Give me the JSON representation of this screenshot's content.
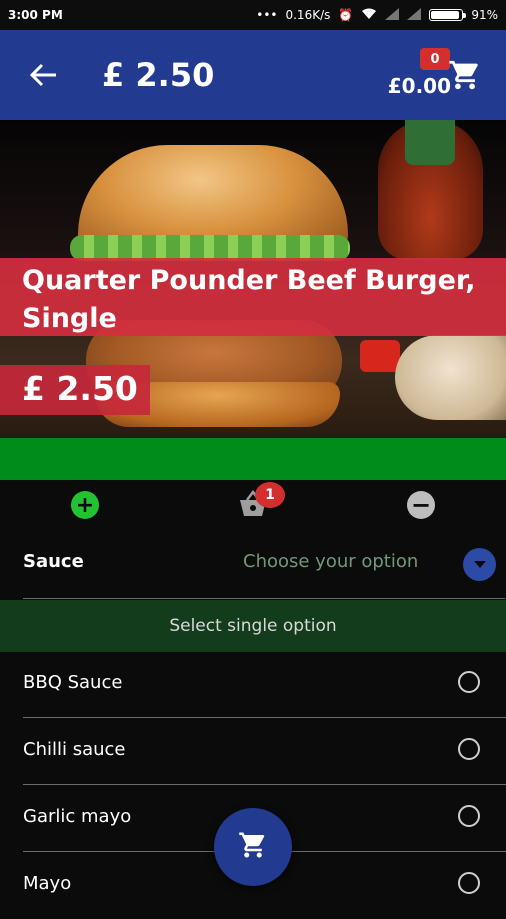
{
  "status_bar": {
    "time": "3:00 PM",
    "speed": "0.16K/s",
    "battery": "91%"
  },
  "app_bar": {
    "title": "£ 2.50",
    "cart_total": "£0.00",
    "cart_count": "0",
    "icons": {
      "back": "arrow-left-icon",
      "cart": "shopping-cart-icon"
    }
  },
  "item": {
    "name": "Quarter Pounder Beef Burger, Single",
    "price": "£ 2.50"
  },
  "quantity": {
    "count": "1",
    "icons": {
      "add": "plus-icon",
      "basket": "basket-icon",
      "remove": "minus-icon"
    }
  },
  "sauce": {
    "label": "Sauce",
    "placeholder": "Choose your option",
    "hint": "Select single option",
    "options": [
      {
        "label": "BBQ Sauce"
      },
      {
        "label": "Chilli sauce"
      },
      {
        "label": "Garlic mayo"
      },
      {
        "label": "Mayo"
      }
    ]
  },
  "colors": {
    "app_bar": "#223a8f",
    "name_banner": "#d32f3f",
    "green_bar": "#008c1a",
    "option_hint_bg": "#123c1c",
    "badge": "#d32f2f"
  }
}
